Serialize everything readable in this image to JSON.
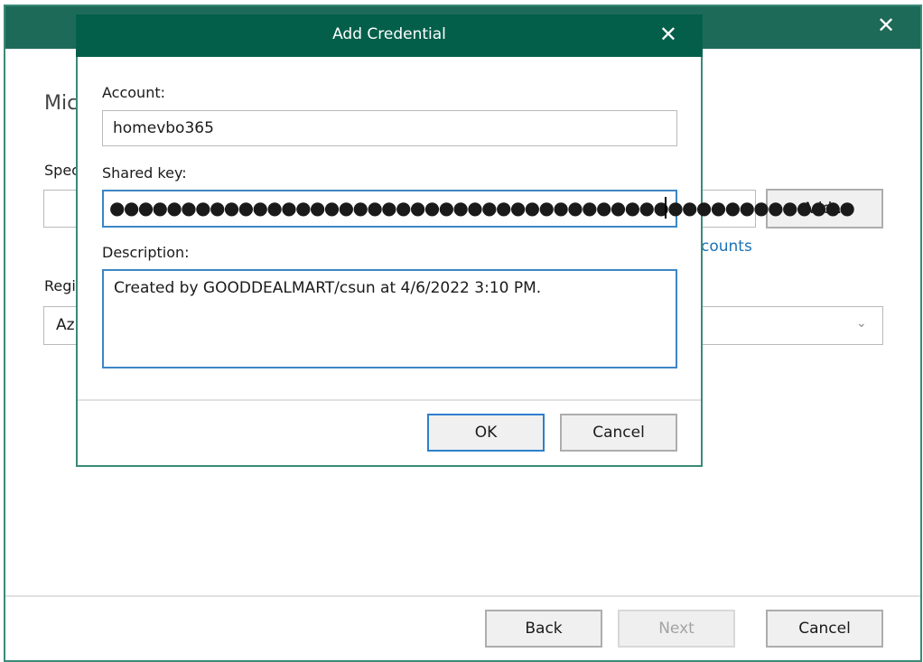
{
  "background_window": {
    "close_icon": "close-icon",
    "heading_fragment": "Mic",
    "spec_label_fragment": "Spec",
    "region_label_fragment": "Regi",
    "region_select_value_fragment": "Az",
    "accounts_link_fragment": "counts",
    "add_button": "Add...",
    "footer": {
      "back": "Back",
      "next": "Next",
      "cancel": "Cancel"
    }
  },
  "dialog": {
    "title": "Add Credential",
    "close_icon": "close-icon",
    "account": {
      "label": "Account:",
      "value": "homevbo365"
    },
    "shared_key": {
      "label": "Shared key:",
      "masked_value": "●●●●●●●●●●●●●●●●●●●●●●●●●●●●●●●●●●●●●●●●●●●●●●●●●●●●"
    },
    "description": {
      "label": "Description:",
      "value": "Created by GOODDEALMART/csun at 4/6/2022 3:10 PM."
    },
    "ok_button": "OK",
    "cancel_button": "Cancel"
  },
  "colors": {
    "window_header": "#1e6a59",
    "dialog_header": "#035f4a",
    "focus_border": "#3c86c6",
    "link": "#1a73b8"
  }
}
